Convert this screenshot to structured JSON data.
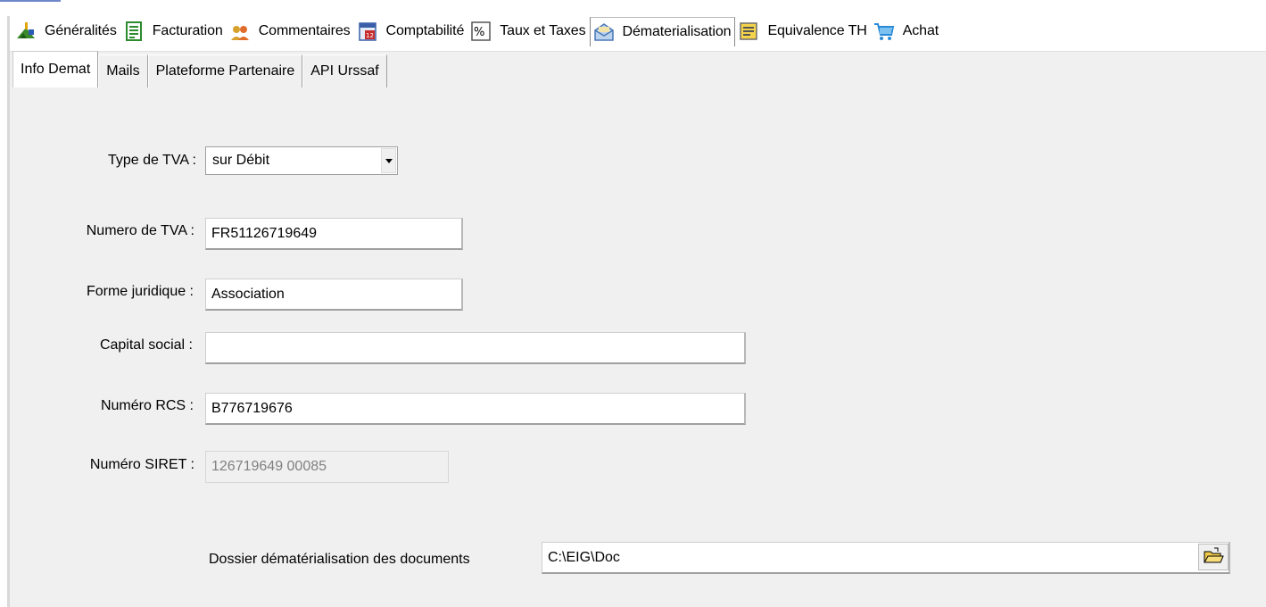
{
  "main_tabs": [
    {
      "label": "Généralités",
      "icon": "generalites-icon"
    },
    {
      "label": "Facturation",
      "icon": "invoice-icon"
    },
    {
      "label": "Commentaires",
      "icon": "people-icon"
    },
    {
      "label": "Comptabilité",
      "icon": "calendar-icon"
    },
    {
      "label": "Taux et Taxes",
      "icon": "percent-icon"
    },
    {
      "label": "Dématerialisation",
      "icon": "envelope-icon"
    },
    {
      "label": "Equivalence TH",
      "icon": "notepad-icon"
    },
    {
      "label": "Achat",
      "icon": "cart-icon"
    }
  ],
  "sub_tabs": [
    {
      "label": "Info Demat"
    },
    {
      "label": "Mails"
    },
    {
      "label": "Plateforme Partenaire"
    },
    {
      "label": "API Urssaf"
    }
  ],
  "form": {
    "tva_type_label": "Type de TVA :",
    "tva_type_value": "sur Débit",
    "tva_number_label": "Numero de TVA :",
    "tva_number_value": "FR51126719649",
    "legal_form_label": "Forme juridique :",
    "legal_form_value": "Association",
    "capital_label": "Capital social :",
    "capital_value": "",
    "rcs_label": "Numéro RCS :",
    "rcs_value": "B776719676",
    "siret_label": "Numéro SIRET :",
    "siret_value": "126719649 00085",
    "folder_label": "Dossier dématérialisation des documents",
    "folder_value": "C:\\EIG\\Doc"
  }
}
